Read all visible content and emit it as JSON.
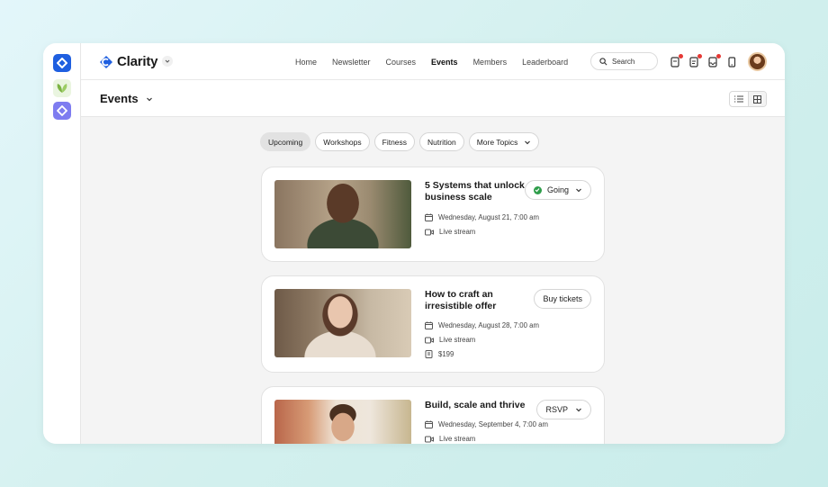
{
  "app": {
    "brand": "Clarity"
  },
  "nav": {
    "items": [
      "Home",
      "Newsletter",
      "Courses",
      "Events",
      "Members",
      "Leaderboard"
    ],
    "active": "Events"
  },
  "search": {
    "label": "Search"
  },
  "page": {
    "title": "Events"
  },
  "filters": [
    "Upcoming",
    "Workshops",
    "Fitness",
    "Nutrition",
    "More Topics"
  ],
  "events": [
    {
      "title": "5 Systems that unlock business scale",
      "date": "Wednesday, August 21, 7:00 am",
      "format": "Live stream",
      "price": "",
      "action": "Going"
    },
    {
      "title": "How to craft an irresistible offer",
      "date": "Wednesday, August 28, 7:00 am",
      "format": "Live stream",
      "price": "$199",
      "action": "Buy tickets"
    },
    {
      "title": "Build, scale and thrive",
      "date": "Wednesday, September 4, 7:00 am",
      "format": "Live stream",
      "price": "",
      "action": "RSVP"
    }
  ],
  "colors": {
    "brand": "#1f5fe0",
    "going": "#2e9d4a",
    "badge": "#e53935"
  }
}
